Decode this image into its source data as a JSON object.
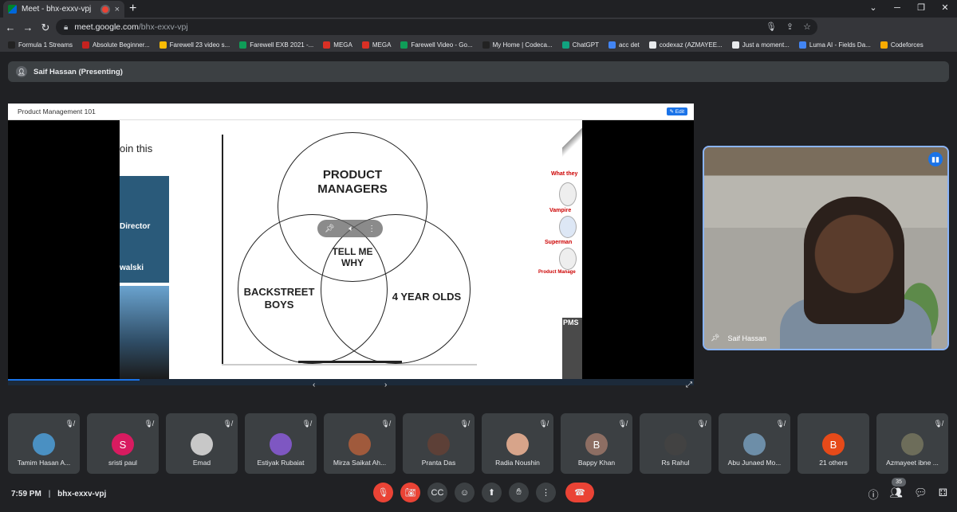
{
  "browser": {
    "tab_title": "Meet - bhx-exxv-vpj",
    "url_host": "meet.google.com",
    "url_path": "/bhx-exxv-vpj",
    "new_tab": "+",
    "close_tab": "×"
  },
  "bookmarks": [
    {
      "label": "Formula 1 Streams",
      "color": "#222222"
    },
    {
      "label": "Absolute Beginner...",
      "color": "#c5221f"
    },
    {
      "label": "Farewell 23 video s...",
      "color": "#fbbc04"
    },
    {
      "label": "Farewell EXB 2021 -...",
      "color": "#0f9d58"
    },
    {
      "label": "MEGA",
      "color": "#d93025"
    },
    {
      "label": "MEGA",
      "color": "#d93025"
    },
    {
      "label": "Farewell Video - Go...",
      "color": "#0f9d58"
    },
    {
      "label": "My Home | Codeca...",
      "color": "#222222"
    },
    {
      "label": "ChatGPT",
      "color": "#10a37f"
    },
    {
      "label": "acc det",
      "color": "#4285f4"
    },
    {
      "label": "codexaz (AZMAYEE...",
      "color": "#e8eaed"
    },
    {
      "label": "Just a moment...",
      "color": "#e8eaed"
    },
    {
      "label": "Luma AI - Fields Da...",
      "color": "#4285f4"
    },
    {
      "label": "Codeforces",
      "color": "#f9ab00"
    }
  ],
  "meeting": {
    "presenter_label": "Saif Hassan (Presenting)",
    "slide_title": "Product Management 101",
    "edit_label": "Edit",
    "slide": {
      "partial_text": "oin this",
      "director_label": "Director",
      "kowalski_label": "walski",
      "circle_top": "PRODUCT MANAGERS",
      "circle_left": "BACKSTREET BOYS",
      "circle_right": "4 YEAR OLDS",
      "center": "TELL ME WHY",
      "right_top": "What they",
      "right_vampire": "Vampire",
      "right_superman": "Superman",
      "right_pm": "Product Manage",
      "right_pms": "PMS"
    },
    "prev_arrow": "‹",
    "next_arrow": "›",
    "camera_name": "Saif Hassan",
    "time": "7:59 PM",
    "meeting_code": "bhx-exxv-vpj",
    "participant_count": "35"
  },
  "participants": [
    {
      "name": "Tamim Hasan A...",
      "initial": "",
      "color": "#4a90c2"
    },
    {
      "name": "sristi paul",
      "initial": "S",
      "color": "#d81b60"
    },
    {
      "name": "Emad",
      "initial": "",
      "color": "#c8c8c8"
    },
    {
      "name": "Estiyak Rubaiat",
      "initial": "",
      "color": "#7e57c2"
    },
    {
      "name": "Mirza Saikat Ah...",
      "initial": "",
      "color": "#a05a3c"
    },
    {
      "name": "Pranta Das",
      "initial": "",
      "color": "#5d4037"
    },
    {
      "name": "Radia Noushin",
      "initial": "",
      "color": "#d7a48a"
    },
    {
      "name": "Bappy Khan",
      "initial": "B",
      "color": "#8d6e63"
    },
    {
      "name": "Rs Rahul",
      "initial": "",
      "color": "#424242"
    },
    {
      "name": "Abu Junaed Mo...",
      "initial": "",
      "color": "#6d8ea8"
    },
    {
      "name": "21 others",
      "initial": "B",
      "color": "#e64a19"
    },
    {
      "name": "Azmayeet ibne ...",
      "initial": "",
      "color": "#6d6d5a"
    }
  ]
}
